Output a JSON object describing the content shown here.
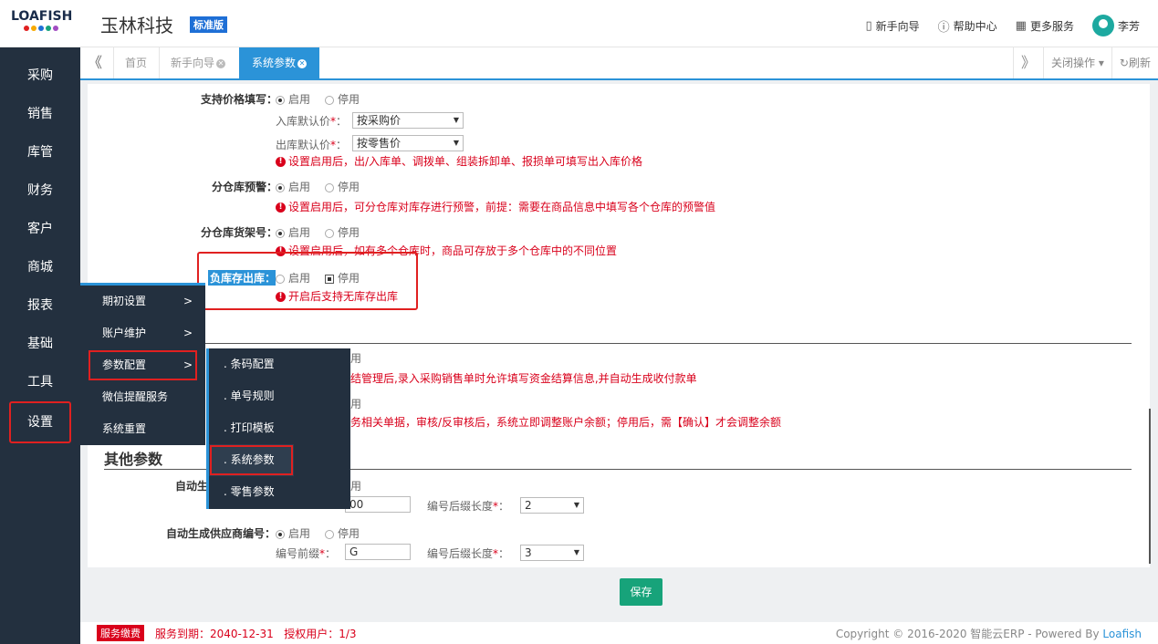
{
  "header": {
    "logo_text": "LOAFISH",
    "company": "玉林科技",
    "edition_badge": "标准版",
    "links": [
      {
        "label": "新手向导",
        "icon": "guide-icon"
      },
      {
        "label": "帮助中心",
        "icon": "help-icon"
      },
      {
        "label": "更多服务",
        "icon": "grid-icon"
      }
    ],
    "user": "李芳",
    "logo_colors": [
      "#e02020",
      "#f7a900",
      "#1e6fd6",
      "#17a37a",
      "#a24cc2"
    ]
  },
  "sidebar": {
    "items": [
      "采购",
      "销售",
      "库管",
      "财务",
      "客户",
      "商城",
      "报表",
      "基础",
      "工具",
      "设置"
    ],
    "active": "设置"
  },
  "tabs": {
    "collapse": "《",
    "items": [
      "首页",
      "新手向导",
      "系统参数"
    ],
    "active": "系统参数",
    "expand": "》",
    "close_ops": "关闭操作",
    "refresh": "刷新"
  },
  "settings": {
    "price_fill": {
      "label": "支持价格填写：",
      "enable": "启用",
      "disable": "停用",
      "in_default_label": "入库默认价",
      "in_default_value": "按采购价",
      "out_default_label": "出库默认价",
      "out_default_value": "按零售价",
      "note": "设置启用后，出/入库单、调拨单、组装拆卸单、报损单可填写出入库价格"
    },
    "warehouse_warning": {
      "label": "分仓库预警：",
      "enable": "启用",
      "disable": "停用",
      "note": "设置启用后，可分仓库对库存进行预警，前提：需要在商品信息中填写各个仓库的预警值"
    },
    "warehouse_shelf": {
      "label": "分仓库货架号：",
      "enable": "启用",
      "disable": "停用",
      "note": "设置启用后，如有多个仓库时，商品可存放于多个仓库中的不同位置"
    },
    "negative_stock": {
      "label": "负库存出库：",
      "enable": "启用",
      "disable": "停用",
      "note": "开启后支持无库存出库"
    },
    "hidden_row1": {
      "disable_tail": "用",
      "note_tail": "结管理后,录入采购销售单时允许填写资金结算信息,并自动生成收付款单"
    },
    "hidden_row2": {
      "disable_tail": "用",
      "note_tail": "务相关单据，审核/反审核后，系统立即调整账户余额；停用后，需【确认】才会调整余额"
    }
  },
  "other_params": {
    "title": "其他参数",
    "auto_customer": {
      "label_partial": "自动生",
      "disable_tail": "用",
      "prefix_value_tail": "00",
      "suffix_len_label": "编号后缀长度",
      "suffix_len_value": "2"
    },
    "auto_supplier": {
      "label": "自动生成供应商编号：",
      "enable": "启用",
      "disable": "停用",
      "prefix_label": "编号前缀",
      "prefix_value": "G",
      "suffix_len_label": "编号后缀长度",
      "suffix_len_value": "3"
    }
  },
  "menu_level1": [
    {
      "label": "期初设置",
      "arrow": ">"
    },
    {
      "label": "账户维护",
      "arrow": ">"
    },
    {
      "label": "参数配置",
      "arrow": ">"
    },
    {
      "label": "微信提醒服务",
      "arrow": ""
    },
    {
      "label": "系统重置",
      "arrow": ""
    }
  ],
  "menu_level2": [
    ". 条码配置",
    ". 单号规则",
    ". 打印模板",
    ". 系统参数",
    ". 零售参数"
  ],
  "save_label": "保存",
  "footer": {
    "fee_badge": "服务缴费",
    "expire": "服务到期：2040-12-31",
    "license": "授权用户：1/3",
    "copyright": "Copyright © 2016-2020 智能云ERP - Powered By ",
    "brand": "Loafish"
  },
  "colors": {
    "accent": "#2b93d8",
    "sidebar_bg": "#23303f",
    "warn": "#d9001b",
    "save": "#17a37a",
    "highlight_box": "#e02020"
  }
}
